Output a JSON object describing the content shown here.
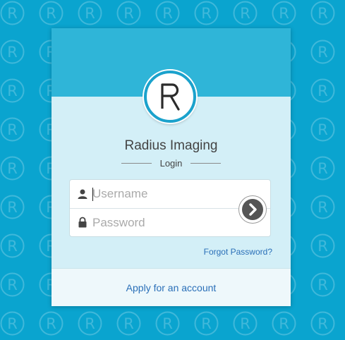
{
  "brand": {
    "name": "Radius Imaging",
    "logo_letter": "R",
    "accent_color": "#0aa4cf",
    "header_color": "#2fb5d8",
    "card_color": "#d3eff7"
  },
  "login": {
    "heading": "Login",
    "username_placeholder": "Username",
    "password_placeholder": "Password",
    "username_icon": "user-icon",
    "password_icon": "lock-icon",
    "submit_icon": "chevron-right-icon",
    "forgot_password": "Forgot Password?"
  },
  "footer": {
    "apply_label": "Apply for an account"
  }
}
